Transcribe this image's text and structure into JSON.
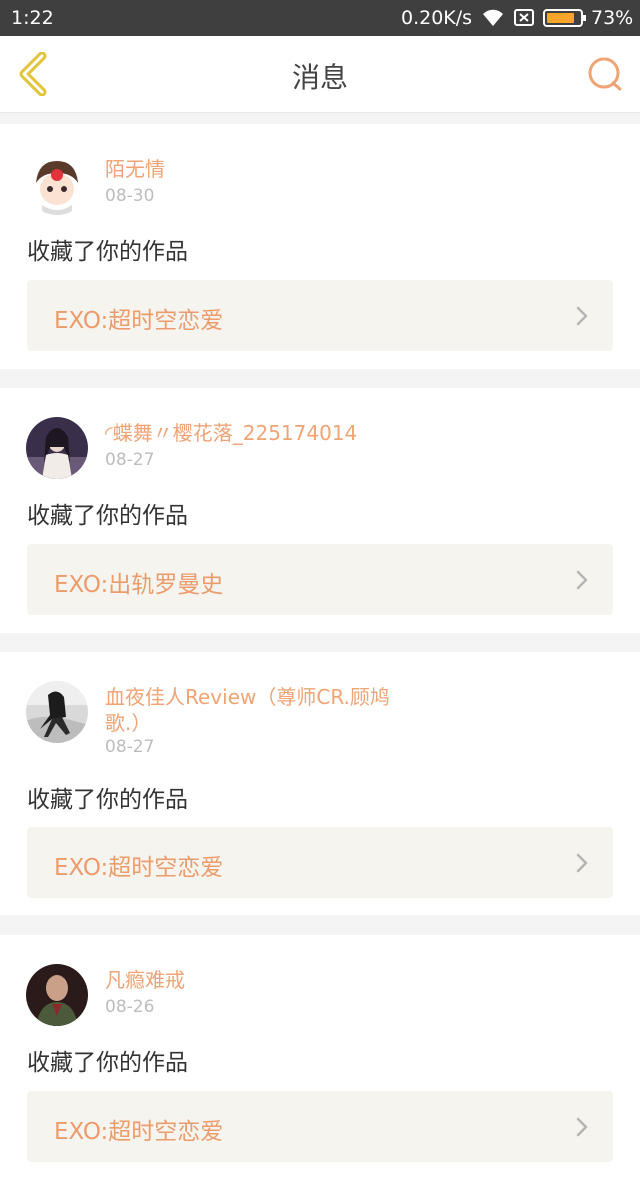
{
  "status_bar": {
    "time": "1:22",
    "network_speed": "0.20K/s",
    "battery": "73%",
    "icons": [
      "wifi-icon",
      "sim-icon",
      "battery-icon"
    ]
  },
  "header": {
    "title": "消息",
    "back_icon": "chevron-left-icon",
    "search_icon": "search-icon"
  },
  "colors": {
    "accent": "#f0a374",
    "back_icon": "#e2c43a",
    "status_bar": "#3f3f3f",
    "battery": "#f7a629"
  },
  "notifications": [
    {
      "username": "陌无情",
      "date": "08-30",
      "action": "收藏了你的作品",
      "work_title": "EXO:超时空恋爱"
    },
    {
      "username": "◜蝶舞〃樱花落_225174014",
      "date": "08-27",
      "action": "收藏了你的作品",
      "work_title": "EXO:出轨罗曼史"
    },
    {
      "username": "血夜佳人Review（尊师CR.顾鸠歌.）",
      "date": "08-27",
      "action": "收藏了你的作品",
      "work_title": "EXO:超时空恋爱"
    },
    {
      "username": "凡瘾难戒",
      "date": "08-26",
      "action": "收藏了你的作品",
      "work_title": "EXO:超时空恋爱"
    }
  ]
}
